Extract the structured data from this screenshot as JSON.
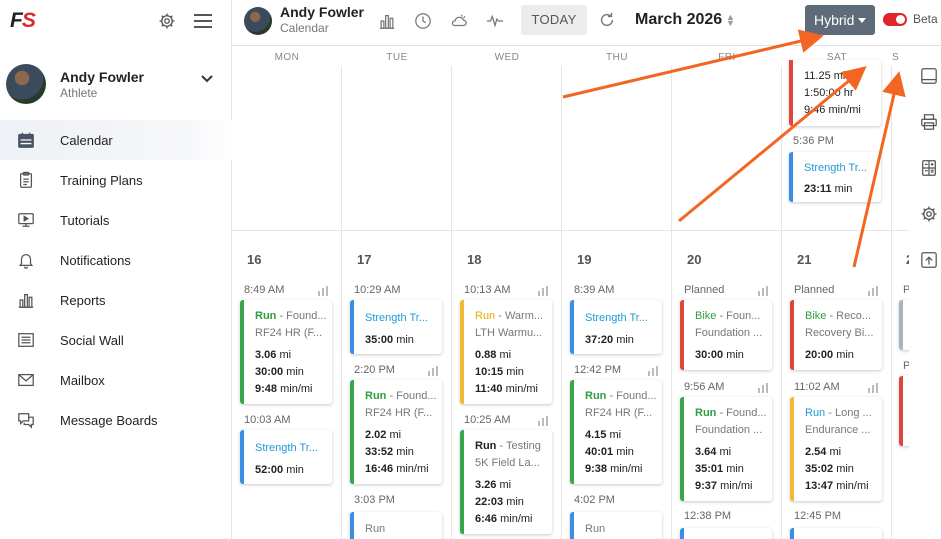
{
  "brand": {
    "logo_f": "F",
    "logo_s": "S"
  },
  "profile": {
    "name": "Andy Fowler",
    "role": "Athlete"
  },
  "nav": [
    {
      "label": "Calendar",
      "icon": "calendar-icon"
    },
    {
      "label": "Training Plans",
      "icon": "clipboard-icon"
    },
    {
      "label": "Tutorials",
      "icon": "video-icon"
    },
    {
      "label": "Notifications",
      "icon": "bell-icon"
    },
    {
      "label": "Reports",
      "icon": "bar-chart-icon"
    },
    {
      "label": "Social Wall",
      "icon": "newspaper-icon"
    },
    {
      "label": "Mailbox",
      "icon": "mail-icon"
    },
    {
      "label": "Message Boards",
      "icon": "chat-icon"
    }
  ],
  "topbar": {
    "name": "Andy Fowler",
    "subtitle": "Calendar",
    "today": "TODAY",
    "month": "March 2026",
    "view": "Hybrid",
    "beta": "Beta"
  },
  "calendar": {
    "weekdays": [
      "MON",
      "TUE",
      "WED",
      "THU",
      "FRI",
      "SAT",
      "S"
    ],
    "days": [
      "16",
      "17",
      "18",
      "19",
      "20",
      "21",
      "2"
    ],
    "prev_week_sat": {
      "metrics": [
        "11.25 mi",
        "1:50:00 hr",
        "9:46 min/mi"
      ],
      "time": "5:36 PM",
      "card": {
        "title": "Strength Tr...",
        "metric": "23:11",
        "unit": "min"
      }
    },
    "mon": {
      "time1": "8:49 AM",
      "card1": {
        "type": "Run",
        "title": " - Found...",
        "sub": "RF24 HR (F...",
        "m": [
          [
            "3.06",
            "mi"
          ],
          [
            "30:00",
            "min"
          ],
          [
            "9:48",
            "min/mi"
          ]
        ]
      },
      "time2": "10:03 AM",
      "card2": {
        "title": "Strength Tr...",
        "metric": "52:00",
        "unit": "min"
      }
    },
    "tue": {
      "time1": "10:29 AM",
      "card1": {
        "title": "Strength Tr...",
        "metric": "35:00",
        "unit": "min"
      },
      "time2": "2:20 PM",
      "card2": {
        "type": "Run",
        "title": " - Found...",
        "sub": "RF24 HR (F...",
        "m": [
          [
            "2.02",
            "mi"
          ],
          [
            "33:52",
            "min"
          ],
          [
            "16:46",
            "min/mi"
          ]
        ]
      },
      "time3": "3:03 PM",
      "card3": {
        "type": "Run"
      }
    },
    "wed": {
      "time1": "10:13 AM",
      "card1": {
        "type": "Run",
        "title": " - Warm...",
        "sub": "LTH Warmu...",
        "m": [
          [
            "0.88",
            "mi"
          ],
          [
            "10:15",
            "min"
          ],
          [
            "11:40",
            "min/mi"
          ]
        ]
      },
      "time2": "10:25 AM",
      "card2": {
        "type": "Run",
        "title": " - Testing",
        "sub": "5K Field La...",
        "m": [
          [
            "3.26",
            "mi"
          ],
          [
            "22:03",
            "min"
          ],
          [
            "6:46",
            "min/mi"
          ]
        ]
      }
    },
    "thu": {
      "time1": "8:39 AM",
      "card1": {
        "title": "Strength Tr...",
        "metric": "37:20",
        "unit": "min"
      },
      "time2": "12:42 PM",
      "card2": {
        "type": "Run",
        "title": " - Found...",
        "sub": "RF24 HR (F...",
        "m": [
          [
            "4.15",
            "mi"
          ],
          [
            "40:01",
            "min"
          ],
          [
            "9:38",
            "min/mi"
          ]
        ]
      },
      "time3": "4:02 PM",
      "card3": {
        "type": "Run"
      }
    },
    "fri": {
      "label1": "Planned",
      "card1": {
        "type": "Bike",
        "title": " - Foun...",
        "sub": "Foundation ...",
        "metric": "30:00",
        "unit": "min"
      },
      "time2": "9:56 AM",
      "card2": {
        "type": "Run",
        "title": " - Found...",
        "sub": "Foundation ...",
        "m": [
          [
            "3.64",
            "mi"
          ],
          [
            "35:01",
            "min"
          ],
          [
            "9:37",
            "min/mi"
          ]
        ]
      },
      "time3": "12:38 PM"
    },
    "sat": {
      "label1": "Planned",
      "card1": {
        "type": "Bike",
        "title": " - Reco...",
        "sub": "Recovery Bi...",
        "metric": "20:00",
        "unit": "min"
      },
      "time2": "11:02 AM",
      "card2": {
        "type": "Run",
        "title": " - Long ...",
        "sub": "Endurance ...",
        "m": [
          [
            "2.54",
            "mi"
          ],
          [
            "35:02",
            "min"
          ],
          [
            "13:47",
            "min/mi"
          ]
        ]
      },
      "time3": "12:45 PM"
    },
    "sun": {
      "label1": "P",
      "label2": "P"
    }
  },
  "colors": {
    "brand_red": "#e0262b",
    "annotation_arrow": "#f26522",
    "hybrid_bg": "#5f6b78"
  }
}
